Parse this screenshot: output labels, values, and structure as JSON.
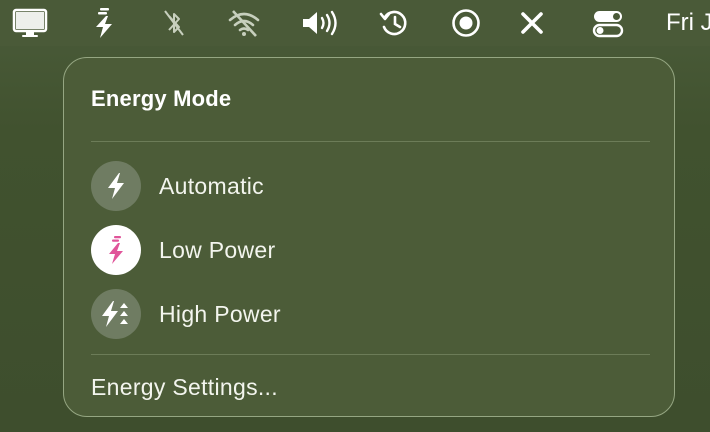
{
  "menubar": {
    "items": [
      {
        "icon": "display-icon"
      },
      {
        "icon": "energy-mode-icon"
      },
      {
        "icon": "bluetooth-off-icon"
      },
      {
        "icon": "wifi-off-icon"
      },
      {
        "icon": "volume-icon"
      },
      {
        "icon": "time-machine-icon"
      },
      {
        "icon": "screen-record-icon"
      },
      {
        "icon": "close-x-icon"
      },
      {
        "icon": "control-center-icon"
      }
    ],
    "clock": "Fri J"
  },
  "panel": {
    "title": "Energy Mode",
    "modes": [
      {
        "label": "Automatic",
        "icon": "bolt-icon",
        "selected": false
      },
      {
        "label": "Low Power",
        "icon": "low-power-bolt-icon",
        "selected": true
      },
      {
        "label": "High Power",
        "icon": "high-power-bolt-icon",
        "selected": false
      }
    ],
    "settings_label": "Energy Settings..."
  },
  "colors": {
    "accent_pink": "#e0559a",
    "background": "#4c5c38",
    "border": "#95a682"
  }
}
